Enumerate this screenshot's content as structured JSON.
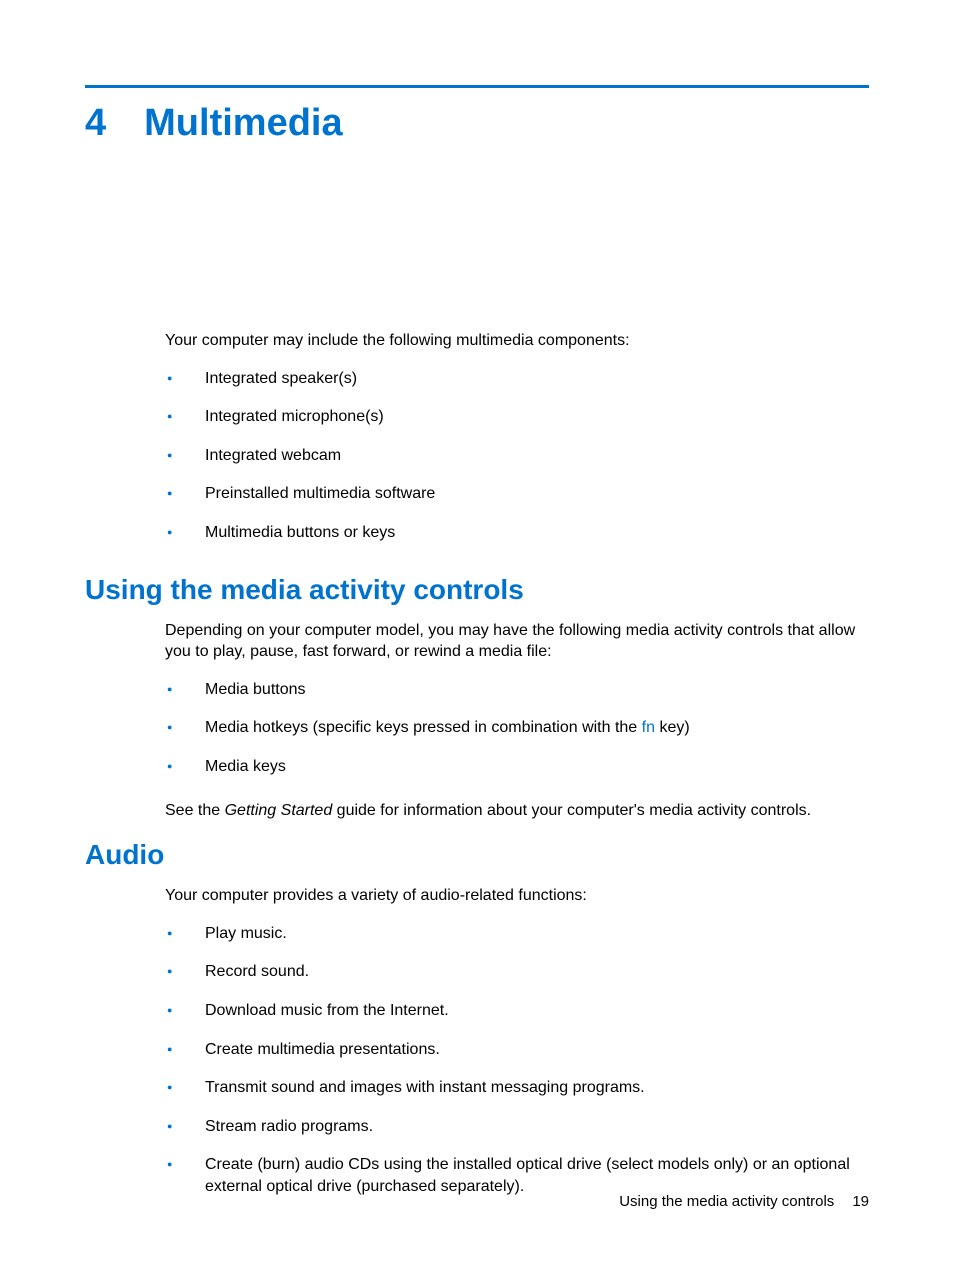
{
  "chapter": {
    "number": "4",
    "title": "Multimedia"
  },
  "intro": "Your computer may include the following multimedia components:",
  "components": [
    "Integrated speaker(s)",
    "Integrated microphone(s)",
    "Integrated webcam",
    "Preinstalled multimedia software",
    "Multimedia buttons or keys"
  ],
  "section1": {
    "heading": "Using the media activity controls",
    "para": "Depending on your computer model, you may have the following media activity controls that allow you to play, pause, fast forward, or rewind a media file:",
    "items": {
      "a": "Media buttons",
      "b_pre": "Media hotkeys (specific keys pressed in combination with the ",
      "b_fn": "fn",
      "b_post": " key)",
      "c": "Media keys"
    },
    "closing_pre": "See the ",
    "closing_em": "Getting Started",
    "closing_post": " guide for information about your computer's media activity controls."
  },
  "section2": {
    "heading": "Audio",
    "para": "Your computer provides a variety of audio-related functions:",
    "items": [
      "Play music.",
      "Record sound.",
      "Download music from the Internet.",
      "Create multimedia presentations.",
      "Transmit sound and images with instant messaging programs.",
      "Stream radio programs.",
      "Create (burn) audio CDs using the installed optical drive (select models only) or an optional external optical drive (purchased separately)."
    ]
  },
  "footer": {
    "text": "Using the media activity controls",
    "page": "19"
  }
}
